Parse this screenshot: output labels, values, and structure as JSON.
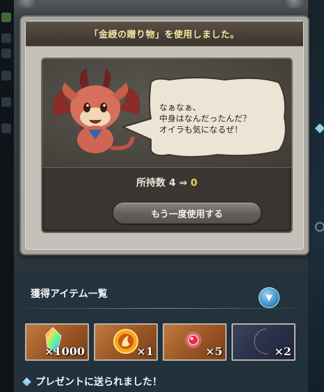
{
  "popup": {
    "title": "「金綬の贈り物」を使用しました。",
    "speech": "なぁなぁ、\n中身はなんだったんだ？\nオイラも気になるぜ！",
    "count_label": "所持数",
    "count_before": "4",
    "arrow": "⇒",
    "count_after": "0",
    "use_again_label": "もう一度使用する"
  },
  "acquired": {
    "title": "獲得アイテム一覧",
    "items": [
      {
        "icon": "rainbow-crystal-icon",
        "qty": "×1000"
      },
      {
        "icon": "fire-orb-icon",
        "qty": "×1"
      },
      {
        "icon": "red-gem-icon",
        "qty": "×5"
      },
      {
        "icon": "moon-icon",
        "qty": "×2"
      }
    ]
  },
  "notice": "プレゼントに送られました！",
  "colors": {
    "title_gold": "#f3e6a0",
    "count_after": "#f5d24a",
    "toggle_blue": "#3a8fc4"
  }
}
